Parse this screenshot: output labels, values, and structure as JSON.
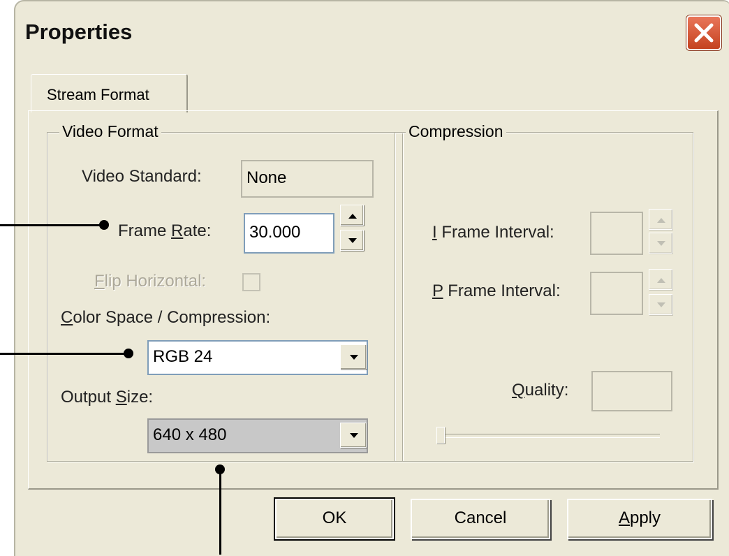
{
  "window": {
    "title": "Properties"
  },
  "tabs": [
    {
      "label": "Stream Format"
    }
  ],
  "video_format": {
    "legend": "Video Format",
    "video_standard": {
      "label": "Video Standard:",
      "value": "None"
    },
    "frame_rate": {
      "label_pre": "Frame ",
      "label_key": "R",
      "label_post": "ate:",
      "value": "30.000"
    },
    "flip_horizontal": {
      "label_key": "F",
      "label_post": "lip Horizontal:"
    },
    "color_space": {
      "label_key": "C",
      "label_post": "olor Space / Compression:",
      "value": "RGB 24"
    },
    "output_size": {
      "label_pre": "Output ",
      "label_key": "S",
      "label_post": "ize:",
      "value": "640 x 480"
    }
  },
  "compression": {
    "legend": "Compression",
    "i_frame": {
      "label_key": "I",
      "label_post": " Frame Interval:"
    },
    "p_frame": {
      "label_key": "P",
      "label_post": " Frame Interval:"
    },
    "quality": {
      "label_key": "Q",
      "label_post": "uality:"
    }
  },
  "buttons": {
    "ok": "OK",
    "cancel": "Cancel",
    "apply_key": "A",
    "apply_post": "pply"
  },
  "colors": {
    "close_button": "#d4502b",
    "dialog_bg": "#ece9d8"
  }
}
